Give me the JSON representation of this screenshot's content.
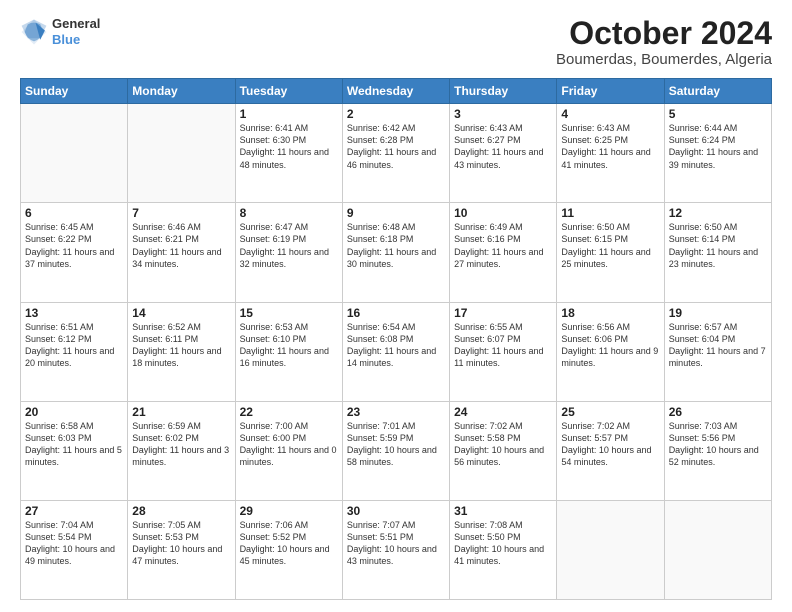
{
  "logo": {
    "line1": "General",
    "line2": "Blue"
  },
  "title": "October 2024",
  "subtitle": "Boumerdas, Boumerdes, Algeria",
  "days_of_week": [
    "Sunday",
    "Monday",
    "Tuesday",
    "Wednesday",
    "Thursday",
    "Friday",
    "Saturday"
  ],
  "weeks": [
    [
      {
        "day": "",
        "content": ""
      },
      {
        "day": "",
        "content": ""
      },
      {
        "day": "1",
        "content": "Sunrise: 6:41 AM\nSunset: 6:30 PM\nDaylight: 11 hours and 48 minutes."
      },
      {
        "day": "2",
        "content": "Sunrise: 6:42 AM\nSunset: 6:28 PM\nDaylight: 11 hours and 46 minutes."
      },
      {
        "day": "3",
        "content": "Sunrise: 6:43 AM\nSunset: 6:27 PM\nDaylight: 11 hours and 43 minutes."
      },
      {
        "day": "4",
        "content": "Sunrise: 6:43 AM\nSunset: 6:25 PM\nDaylight: 11 hours and 41 minutes."
      },
      {
        "day": "5",
        "content": "Sunrise: 6:44 AM\nSunset: 6:24 PM\nDaylight: 11 hours and 39 minutes."
      }
    ],
    [
      {
        "day": "6",
        "content": "Sunrise: 6:45 AM\nSunset: 6:22 PM\nDaylight: 11 hours and 37 minutes."
      },
      {
        "day": "7",
        "content": "Sunrise: 6:46 AM\nSunset: 6:21 PM\nDaylight: 11 hours and 34 minutes."
      },
      {
        "day": "8",
        "content": "Sunrise: 6:47 AM\nSunset: 6:19 PM\nDaylight: 11 hours and 32 minutes."
      },
      {
        "day": "9",
        "content": "Sunrise: 6:48 AM\nSunset: 6:18 PM\nDaylight: 11 hours and 30 minutes."
      },
      {
        "day": "10",
        "content": "Sunrise: 6:49 AM\nSunset: 6:16 PM\nDaylight: 11 hours and 27 minutes."
      },
      {
        "day": "11",
        "content": "Sunrise: 6:50 AM\nSunset: 6:15 PM\nDaylight: 11 hours and 25 minutes."
      },
      {
        "day": "12",
        "content": "Sunrise: 6:50 AM\nSunset: 6:14 PM\nDaylight: 11 hours and 23 minutes."
      }
    ],
    [
      {
        "day": "13",
        "content": "Sunrise: 6:51 AM\nSunset: 6:12 PM\nDaylight: 11 hours and 20 minutes."
      },
      {
        "day": "14",
        "content": "Sunrise: 6:52 AM\nSunset: 6:11 PM\nDaylight: 11 hours and 18 minutes."
      },
      {
        "day": "15",
        "content": "Sunrise: 6:53 AM\nSunset: 6:10 PM\nDaylight: 11 hours and 16 minutes."
      },
      {
        "day": "16",
        "content": "Sunrise: 6:54 AM\nSunset: 6:08 PM\nDaylight: 11 hours and 14 minutes."
      },
      {
        "day": "17",
        "content": "Sunrise: 6:55 AM\nSunset: 6:07 PM\nDaylight: 11 hours and 11 minutes."
      },
      {
        "day": "18",
        "content": "Sunrise: 6:56 AM\nSunset: 6:06 PM\nDaylight: 11 hours and 9 minutes."
      },
      {
        "day": "19",
        "content": "Sunrise: 6:57 AM\nSunset: 6:04 PM\nDaylight: 11 hours and 7 minutes."
      }
    ],
    [
      {
        "day": "20",
        "content": "Sunrise: 6:58 AM\nSunset: 6:03 PM\nDaylight: 11 hours and 5 minutes."
      },
      {
        "day": "21",
        "content": "Sunrise: 6:59 AM\nSunset: 6:02 PM\nDaylight: 11 hours and 3 minutes."
      },
      {
        "day": "22",
        "content": "Sunrise: 7:00 AM\nSunset: 6:00 PM\nDaylight: 11 hours and 0 minutes."
      },
      {
        "day": "23",
        "content": "Sunrise: 7:01 AM\nSunset: 5:59 PM\nDaylight: 10 hours and 58 minutes."
      },
      {
        "day": "24",
        "content": "Sunrise: 7:02 AM\nSunset: 5:58 PM\nDaylight: 10 hours and 56 minutes."
      },
      {
        "day": "25",
        "content": "Sunrise: 7:02 AM\nSunset: 5:57 PM\nDaylight: 10 hours and 54 minutes."
      },
      {
        "day": "26",
        "content": "Sunrise: 7:03 AM\nSunset: 5:56 PM\nDaylight: 10 hours and 52 minutes."
      }
    ],
    [
      {
        "day": "27",
        "content": "Sunrise: 7:04 AM\nSunset: 5:54 PM\nDaylight: 10 hours and 49 minutes."
      },
      {
        "day": "28",
        "content": "Sunrise: 7:05 AM\nSunset: 5:53 PM\nDaylight: 10 hours and 47 minutes."
      },
      {
        "day": "29",
        "content": "Sunrise: 7:06 AM\nSunset: 5:52 PM\nDaylight: 10 hours and 45 minutes."
      },
      {
        "day": "30",
        "content": "Sunrise: 7:07 AM\nSunset: 5:51 PM\nDaylight: 10 hours and 43 minutes."
      },
      {
        "day": "31",
        "content": "Sunrise: 7:08 AM\nSunset: 5:50 PM\nDaylight: 10 hours and 41 minutes."
      },
      {
        "day": "",
        "content": ""
      },
      {
        "day": "",
        "content": ""
      }
    ]
  ]
}
